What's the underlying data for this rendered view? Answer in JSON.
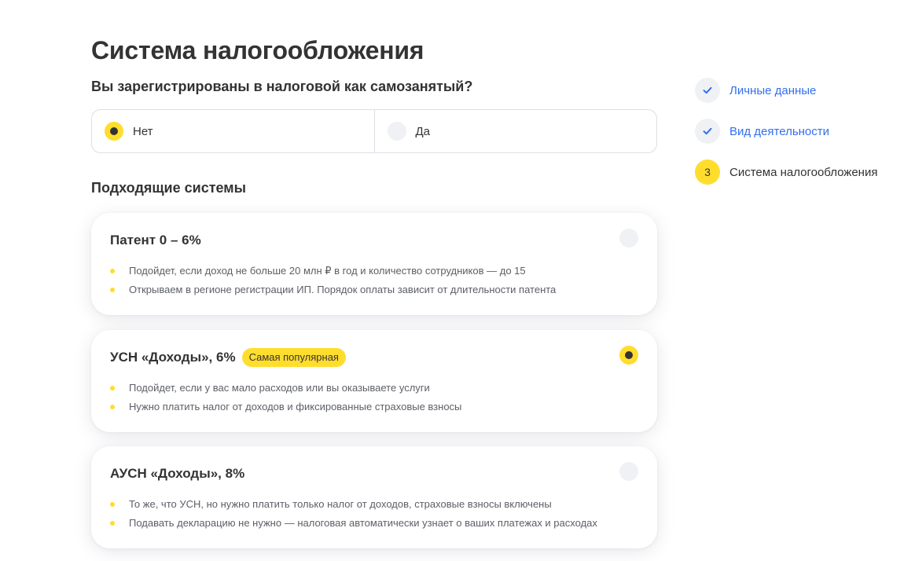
{
  "title": "Система налогообложения",
  "question": "Вы зарегистрированы в налоговой как самозанятый?",
  "self_employed": {
    "options": [
      {
        "label": "Нет",
        "checked": true
      },
      {
        "label": "Да",
        "checked": false
      }
    ]
  },
  "systems_title": "Подходящие системы",
  "systems": [
    {
      "title": "Патент 0 – 6%",
      "badge": "",
      "selected": false,
      "bullets": [
        "Подойдет, если доход не больше 20 млн ₽ в год и количество сотрудников — до 15",
        "Открываем в регионе регистрации ИП. Порядок оплаты зависит от длительности патента"
      ]
    },
    {
      "title": "УСН «Доходы», 6%",
      "badge": "Самая популярная",
      "selected": true,
      "bullets": [
        "Подойдет, если у вас мало расходов или вы оказываете услуги",
        "Нужно платить налог от доходов и фиксированные страховые взносы"
      ]
    },
    {
      "title": "АУСН «Доходы», 8%",
      "badge": "",
      "selected": false,
      "bullets": [
        "То же, что УСН, но нужно платить только налог от доходов, страховые взносы включены",
        "Подавать декларацию не нужно — налоговая автоматически узнает о ваших платежах и расходах"
      ]
    }
  ],
  "steps": [
    {
      "label": "Личные данные",
      "status": "done",
      "icon": "check-icon"
    },
    {
      "label": "Вид деятельности",
      "status": "done",
      "icon": "check-icon"
    },
    {
      "label": "Система налогообложения",
      "status": "current",
      "number": "3"
    }
  ],
  "colors": {
    "accent": "#ffdd2d",
    "link": "#336fee",
    "text": "#333333",
    "muted": "#5c5f66",
    "radio_empty": "#eff1f5"
  }
}
